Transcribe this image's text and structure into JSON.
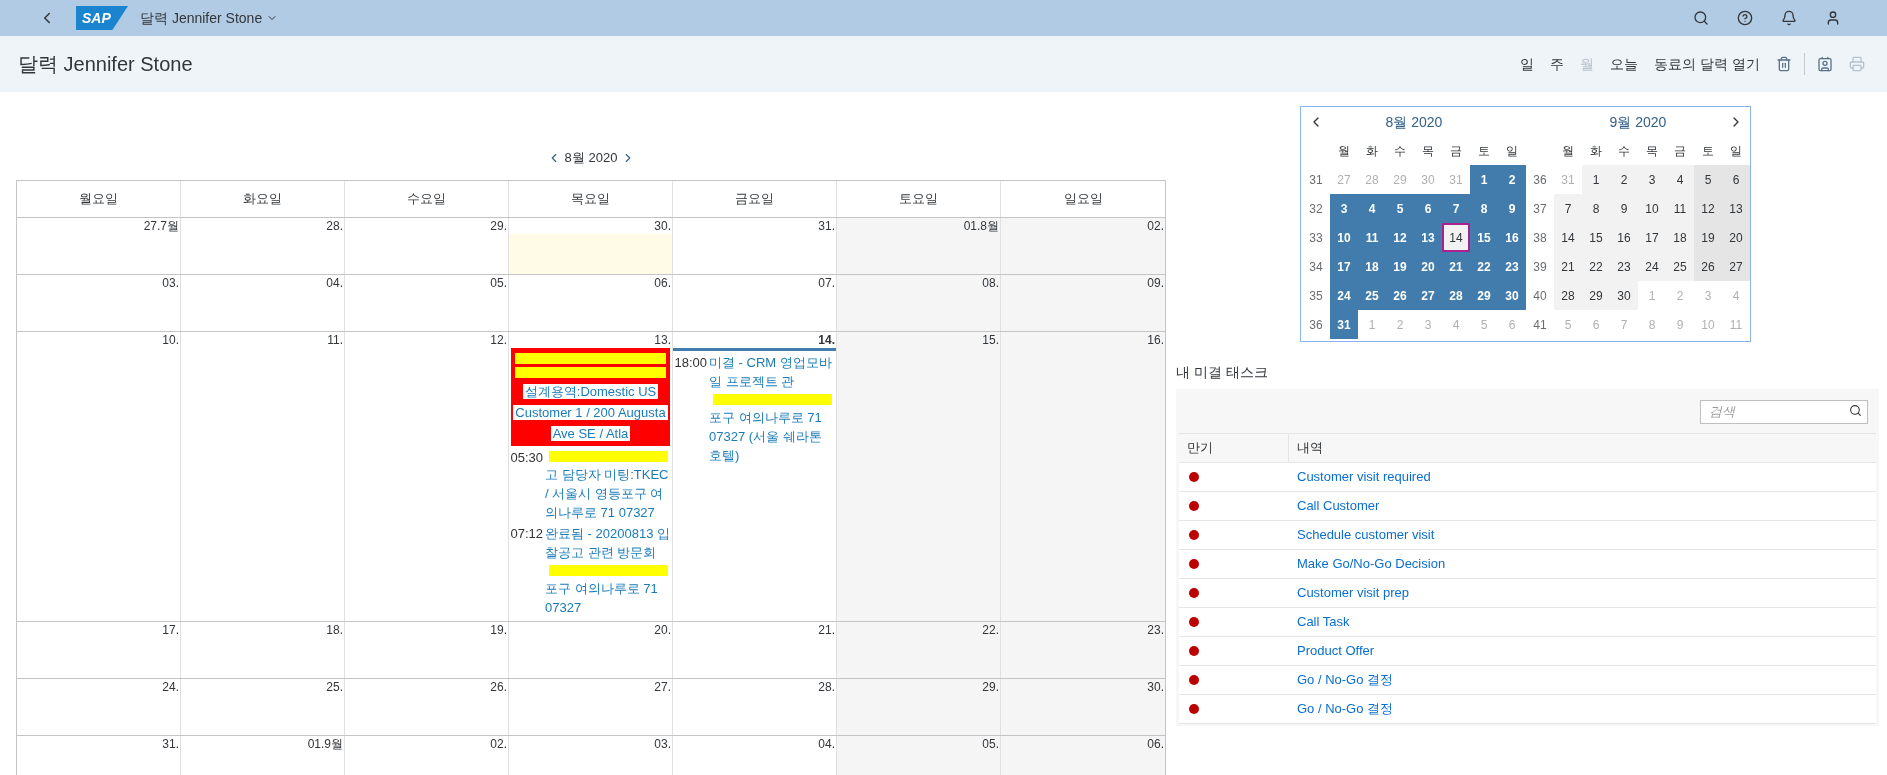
{
  "shell": {
    "logo": "SAP",
    "title": "달력 Jennifer Stone"
  },
  "page": {
    "title": "달력 Jennifer Stone",
    "toolbar": [
      {
        "kind": "text",
        "label": "일",
        "disabled": false
      },
      {
        "kind": "text",
        "label": "주",
        "disabled": false
      },
      {
        "kind": "text",
        "label": "월",
        "disabled": true
      },
      {
        "kind": "text",
        "label": "오늘",
        "disabled": false
      },
      {
        "kind": "text",
        "label": "동료의 달력 열기",
        "disabled": false
      },
      {
        "kind": "trash",
        "disabled": false
      },
      {
        "kind": "person-card",
        "disabled": false
      },
      {
        "kind": "print",
        "disabled": true
      }
    ]
  },
  "month_view": {
    "title": "8월 2020",
    "weekdays": [
      "월요일",
      "화요일",
      "수요일",
      "목요일",
      "금요일",
      "토요일",
      "일요일"
    ],
    "weeks": [
      [
        {
          "label": "27.7월",
          "today": false,
          "highlighted": false
        },
        {
          "label": "28.",
          "today": false,
          "highlighted": false
        },
        {
          "label": "29.",
          "today": false,
          "highlighted": false
        },
        {
          "label": "30.",
          "today": false,
          "highlighted": true
        },
        {
          "label": "31.",
          "today": false,
          "highlighted": false
        },
        {
          "label": "01.8월",
          "today": false,
          "highlighted": false
        },
        {
          "label": "02.",
          "today": false,
          "highlighted": false
        }
      ],
      [
        {
          "label": "03.",
          "today": false,
          "highlighted": false
        },
        {
          "label": "04.",
          "today": false,
          "highlighted": false
        },
        {
          "label": "05.",
          "today": false,
          "highlighted": false
        },
        {
          "label": "06.",
          "today": false,
          "highlighted": false
        },
        {
          "label": "07.",
          "today": false,
          "highlighted": false
        },
        {
          "label": "08.",
          "today": false,
          "highlighted": false
        },
        {
          "label": "09.",
          "today": false,
          "highlighted": false
        }
      ],
      [
        {
          "label": "10.",
          "today": false,
          "highlighted": false
        },
        {
          "label": "11.",
          "today": false,
          "highlighted": false
        },
        {
          "label": "12.",
          "today": false,
          "highlighted": false
        },
        {
          "label": "13.",
          "today": false,
          "highlighted": false,
          "events": [
            {
              "kind": "block",
              "parts": [
                {
                  "kind": "redacted"
                },
                {
                  "kind": "redacted"
                },
                {
                  "kind": "text",
                  "text": "설계용역:Domestic US Customer 1 / 200 Augusta Ave SE / Atla"
                }
              ]
            },
            {
              "kind": "timed",
              "time": "05:30",
              "parts": [
                {
                  "kind": "redacted"
                },
                {
                  "kind": "text",
                  "text": "고 담당자 미팅:TKEC / 서울시 영등포구 여의나루로 71 07327"
                }
              ]
            },
            {
              "kind": "timed",
              "time": "07:12",
              "parts": [
                {
                  "kind": "text",
                  "text": "완료됨 - 20200813 입찰공고 관련 방문회"
                },
                {
                  "kind": "redacted"
                },
                {
                  "kind": "text",
                  "text": "포구 여의나루로 71 07327"
                }
              ]
            }
          ]
        },
        {
          "label": "14.",
          "today": true,
          "highlighted": false,
          "events": [
            {
              "kind": "timed",
              "time": "18:00",
              "parts": [
                {
                  "kind": "text",
                  "text": "미결 - CRM 영업모바일 프로젝트 관"
                },
                {
                  "kind": "redacted"
                },
                {
                  "kind": "text",
                  "text": "포구 여의나루로 71 07327 (서울 쉐라톤 호텔)"
                }
              ]
            }
          ]
        },
        {
          "label": "15.",
          "today": false,
          "highlighted": false
        },
        {
          "label": "16.",
          "today": false,
          "highlighted": false
        }
      ],
      [
        {
          "label": "17.",
          "today": false,
          "highlighted": false
        },
        {
          "label": "18.",
          "today": false,
          "highlighted": false
        },
        {
          "label": "19.",
          "today": false,
          "highlighted": false
        },
        {
          "label": "20.",
          "today": false,
          "highlighted": false
        },
        {
          "label": "21.",
          "today": false,
          "highlighted": false
        },
        {
          "label": "22.",
          "today": false,
          "highlighted": false
        },
        {
          "label": "23.",
          "today": false,
          "highlighted": false
        }
      ],
      [
        {
          "label": "24.",
          "today": false,
          "highlighted": false
        },
        {
          "label": "25.",
          "today": false,
          "highlighted": false
        },
        {
          "label": "26.",
          "today": false,
          "highlighted": false
        },
        {
          "label": "27.",
          "today": false,
          "highlighted": false
        },
        {
          "label": "28.",
          "today": false,
          "highlighted": false
        },
        {
          "label": "29.",
          "today": false,
          "highlighted": false
        },
        {
          "label": "30.",
          "today": false,
          "highlighted": false
        }
      ],
      [
        {
          "label": "31.",
          "today": false,
          "highlighted": false
        },
        {
          "label": "01.9월",
          "today": false,
          "highlighted": false
        },
        {
          "label": "02.",
          "today": false,
          "highlighted": false
        },
        {
          "label": "03.",
          "today": false,
          "highlighted": false
        },
        {
          "label": "04.",
          "today": false,
          "highlighted": false
        },
        {
          "label": "05.",
          "today": false,
          "highlighted": false
        },
        {
          "label": "06.",
          "today": false,
          "highlighted": false
        }
      ]
    ]
  },
  "mini_calendar": {
    "months": [
      {
        "title": "8월 2020",
        "weekdays": [
          "월",
          "화",
          "수",
          "목",
          "금",
          "토",
          "일"
        ],
        "weeks": [
          {
            "number": "31",
            "days": [
              {
                "d": "27",
                "other": true,
                "selected": false,
                "today": false
              },
              {
                "d": "28",
                "other": true,
                "selected": false,
                "today": false
              },
              {
                "d": "29",
                "other": true,
                "selected": false,
                "today": false
              },
              {
                "d": "30",
                "other": true,
                "selected": false,
                "today": false
              },
              {
                "d": "31",
                "other": true,
                "selected": false,
                "today": false
              },
              {
                "d": "1",
                "other": false,
                "selected": true,
                "today": false
              },
              {
                "d": "2",
                "other": false,
                "selected": true,
                "today": false
              }
            ]
          },
          {
            "number": "32",
            "days": [
              {
                "d": "3",
                "other": false,
                "selected": true,
                "today": false
              },
              {
                "d": "4",
                "other": false,
                "selected": true,
                "today": false
              },
              {
                "d": "5",
                "other": false,
                "selected": true,
                "today": false
              },
              {
                "d": "6",
                "other": false,
                "selected": true,
                "today": false
              },
              {
                "d": "7",
                "other": false,
                "selected": true,
                "today": false
              },
              {
                "d": "8",
                "other": false,
                "selected": true,
                "today": false
              },
              {
                "d": "9",
                "other": false,
                "selected": true,
                "today": false
              }
            ]
          },
          {
            "number": "33",
            "days": [
              {
                "d": "10",
                "other": false,
                "selected": true,
                "today": false
              },
              {
                "d": "11",
                "other": false,
                "selected": true,
                "today": false
              },
              {
                "d": "12",
                "other": false,
                "selected": true,
                "today": false
              },
              {
                "d": "13",
                "other": false,
                "selected": true,
                "today": false
              },
              {
                "d": "14",
                "other": false,
                "selected": false,
                "today": true
              },
              {
                "d": "15",
                "other": false,
                "selected": true,
                "today": false
              },
              {
                "d": "16",
                "other": false,
                "selected": true,
                "today": false
              }
            ]
          },
          {
            "number": "34",
            "days": [
              {
                "d": "17",
                "other": false,
                "selected": true,
                "today": false
              },
              {
                "d": "18",
                "other": false,
                "selected": true,
                "today": false
              },
              {
                "d": "19",
                "other": false,
                "selected": true,
                "today": false
              },
              {
                "d": "20",
                "other": false,
                "selected": true,
                "today": false
              },
              {
                "d": "21",
                "other": false,
                "selected": true,
                "today": false
              },
              {
                "d": "22",
                "other": false,
                "selected": true,
                "today": false
              },
              {
                "d": "23",
                "other": false,
                "selected": true,
                "today": false
              }
            ]
          },
          {
            "number": "35",
            "days": [
              {
                "d": "24",
                "other": false,
                "selected": true,
                "today": false
              },
              {
                "d": "25",
                "other": false,
                "selected": true,
                "today": false
              },
              {
                "d": "26",
                "other": false,
                "selected": true,
                "today": false
              },
              {
                "d": "27",
                "other": false,
                "selected": true,
                "today": false
              },
              {
                "d": "28",
                "other": false,
                "selected": true,
                "today": false
              },
              {
                "d": "29",
                "other": false,
                "selected": true,
                "today": false
              },
              {
                "d": "30",
                "other": false,
                "selected": true,
                "today": false
              }
            ]
          },
          {
            "number": "36",
            "days": [
              {
                "d": "31",
                "other": false,
                "selected": true,
                "today": false
              },
              {
                "d": "1",
                "other": true,
                "selected": false,
                "today": false
              },
              {
                "d": "2",
                "other": true,
                "selected": false,
                "today": false
              },
              {
                "d": "3",
                "other": true,
                "selected": false,
                "today": false
              },
              {
                "d": "4",
                "other": true,
                "selected": false,
                "today": false
              },
              {
                "d": "5",
                "other": true,
                "selected": false,
                "today": false
              },
              {
                "d": "6",
                "other": true,
                "selected": false,
                "today": false
              }
            ]
          }
        ]
      },
      {
        "title": "9월 2020",
        "weekdays": [
          "월",
          "화",
          "수",
          "목",
          "금",
          "토",
          "일"
        ],
        "weeks": [
          {
            "number": "36",
            "days": [
              {
                "d": "31",
                "other": true,
                "selected": false,
                "today": false
              },
              {
                "d": "1",
                "other": false,
                "selected": false,
                "today": false
              },
              {
                "d": "2",
                "other": false,
                "selected": false,
                "today": false
              },
              {
                "d": "3",
                "other": false,
                "selected": false,
                "today": false
              },
              {
                "d": "4",
                "other": false,
                "selected": false,
                "today": false
              },
              {
                "d": "5",
                "other": false,
                "selected": false,
                "today": false
              },
              {
                "d": "6",
                "other": false,
                "selected": false,
                "today": false
              }
            ]
          },
          {
            "number": "37",
            "days": [
              {
                "d": "7",
                "other": false,
                "selected": false,
                "today": false
              },
              {
                "d": "8",
                "other": false,
                "selected": false,
                "today": false
              },
              {
                "d": "9",
                "other": false,
                "selected": false,
                "today": false
              },
              {
                "d": "10",
                "other": false,
                "selected": false,
                "today": false
              },
              {
                "d": "11",
                "other": false,
                "selected": false,
                "today": false
              },
              {
                "d": "12",
                "other": false,
                "selected": false,
                "today": false
              },
              {
                "d": "13",
                "other": false,
                "selected": false,
                "today": false
              }
            ]
          },
          {
            "number": "38",
            "days": [
              {
                "d": "14",
                "other": false,
                "selected": false,
                "today": false
              },
              {
                "d": "15",
                "other": false,
                "selected": false,
                "today": false
              },
              {
                "d": "16",
                "other": false,
                "selected": false,
                "today": false
              },
              {
                "d": "17",
                "other": false,
                "selected": false,
                "today": false
              },
              {
                "d": "18",
                "other": false,
                "selected": false,
                "today": false
              },
              {
                "d": "19",
                "other": false,
                "selected": false,
                "today": false
              },
              {
                "d": "20",
                "other": false,
                "selected": false,
                "today": false
              }
            ]
          },
          {
            "number": "39",
            "days": [
              {
                "d": "21",
                "other": false,
                "selected": false,
                "today": false
              },
              {
                "d": "22",
                "other": false,
                "selected": false,
                "today": false
              },
              {
                "d": "23",
                "other": false,
                "selected": false,
                "today": false
              },
              {
                "d": "24",
                "other": false,
                "selected": false,
                "today": false
              },
              {
                "d": "25",
                "other": false,
                "selected": false,
                "today": false
              },
              {
                "d": "26",
                "other": false,
                "selected": false,
                "today": false
              },
              {
                "d": "27",
                "other": false,
                "selected": false,
                "today": false
              }
            ]
          },
          {
            "number": "40",
            "days": [
              {
                "d": "28",
                "other": false,
                "selected": false,
                "today": false
              },
              {
                "d": "29",
                "other": false,
                "selected": false,
                "today": false
              },
              {
                "d": "30",
                "other": false,
                "selected": false,
                "today": false
              },
              {
                "d": "1",
                "other": true,
                "selected": false,
                "today": false
              },
              {
                "d": "2",
                "other": true,
                "selected": false,
                "today": false
              },
              {
                "d": "3",
                "other": true,
                "selected": false,
                "today": false
              },
              {
                "d": "4",
                "other": true,
                "selected": false,
                "today": false
              }
            ]
          },
          {
            "number": "41",
            "days": [
              {
                "d": "5",
                "other": true,
                "selected": false,
                "today": false
              },
              {
                "d": "6",
                "other": true,
                "selected": false,
                "today": false
              },
              {
                "d": "7",
                "other": true,
                "selected": false,
                "today": false
              },
              {
                "d": "8",
                "other": true,
                "selected": false,
                "today": false
              },
              {
                "d": "9",
                "other": true,
                "selected": false,
                "today": false
              },
              {
                "d": "10",
                "other": true,
                "selected": false,
                "today": false
              },
              {
                "d": "11",
                "other": true,
                "selected": false,
                "today": false
              }
            ]
          }
        ]
      }
    ]
  },
  "tasks": {
    "title": "내 미결 태스크",
    "search": {
      "placeholder": "검색"
    },
    "columns": [
      "만기",
      "내역"
    ],
    "rows": [
      {
        "text": "Customer visit required",
        "color": "#bb0000"
      },
      {
        "text": "Call Customer",
        "color": "#bb0000"
      },
      {
        "text": "Schedule customer visit",
        "color": "#bb0000"
      },
      {
        "text": "Make Go/No-Go Decision",
        "color": "#bb0000"
      },
      {
        "text": "Customer visit prep",
        "color": "#bb0000"
      },
      {
        "text": "Call Task",
        "color": "#bb0000"
      },
      {
        "text": "Product Offer",
        "color": "#bb0000"
      },
      {
        "text": "Go / No-Go 결정",
        "color": "#bb0000"
      },
      {
        "text": "Go / No-Go 결정",
        "color": "#bb0000"
      }
    ]
  }
}
